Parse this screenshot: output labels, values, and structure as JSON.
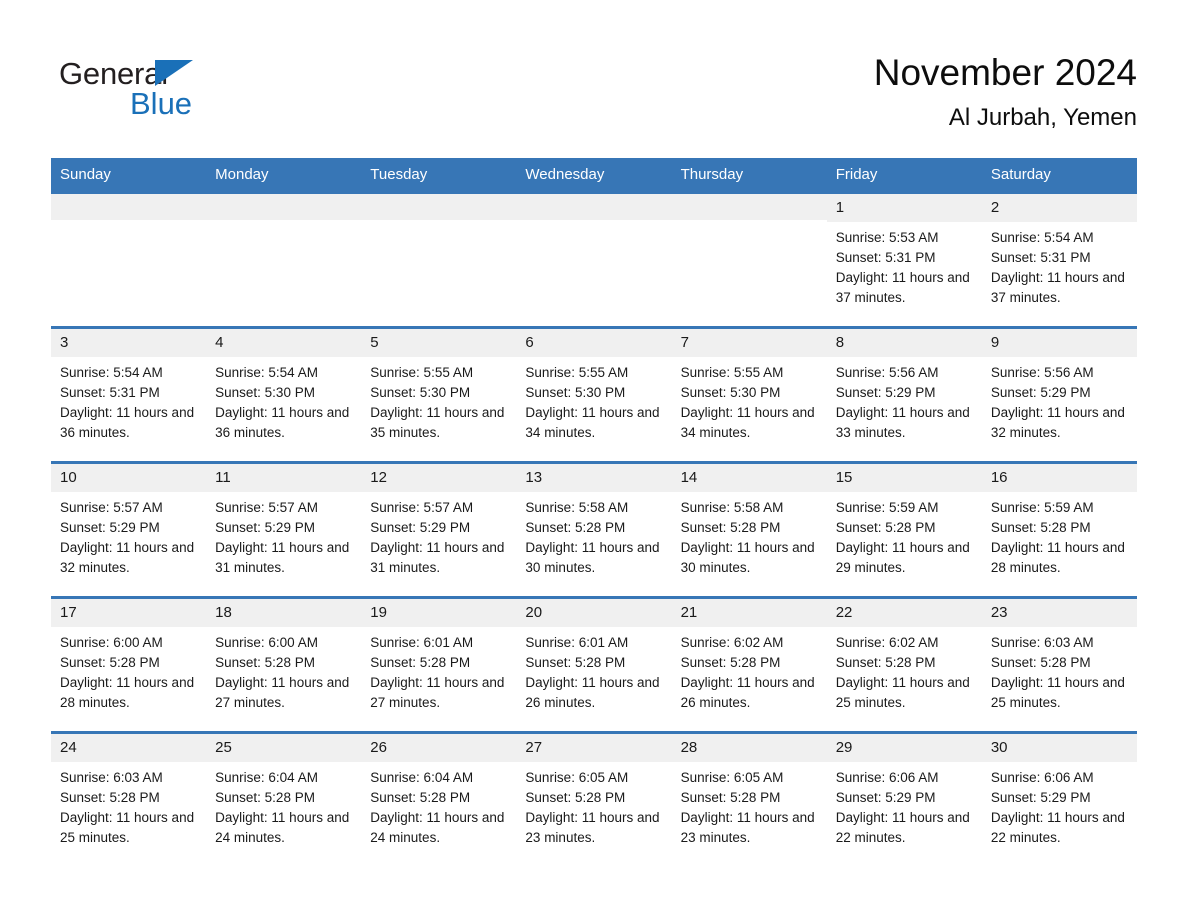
{
  "brand": {
    "name_top": "General",
    "name_bottom": "Blue",
    "triangle_color": "#1a70b8"
  },
  "header": {
    "title": "November 2024",
    "subtitle": "Al Jurbah, Yemen"
  },
  "theme": {
    "header_blue": "#3776b6",
    "daynum_band": "#f0f0f0",
    "text": "#1a1a1a"
  },
  "weekday_headers": [
    "Sunday",
    "Monday",
    "Tuesday",
    "Wednesday",
    "Thursday",
    "Friday",
    "Saturday"
  ],
  "labels": {
    "sunrise_prefix": "Sunrise:",
    "sunset_prefix": "Sunset:",
    "daylight_prefix": "Daylight:"
  },
  "weeks": [
    [
      {
        "day": "",
        "sunrise": "",
        "sunset": "",
        "daylight": ""
      },
      {
        "day": "",
        "sunrise": "",
        "sunset": "",
        "daylight": ""
      },
      {
        "day": "",
        "sunrise": "",
        "sunset": "",
        "daylight": ""
      },
      {
        "day": "",
        "sunrise": "",
        "sunset": "",
        "daylight": ""
      },
      {
        "day": "",
        "sunrise": "",
        "sunset": "",
        "daylight": ""
      },
      {
        "day": "1",
        "sunrise": "Sunrise: 5:53 AM",
        "sunset": "Sunset: 5:31 PM",
        "daylight": "Daylight: 11 hours and 37 minutes."
      },
      {
        "day": "2",
        "sunrise": "Sunrise: 5:54 AM",
        "sunset": "Sunset: 5:31 PM",
        "daylight": "Daylight: 11 hours and 37 minutes."
      }
    ],
    [
      {
        "day": "3",
        "sunrise": "Sunrise: 5:54 AM",
        "sunset": "Sunset: 5:31 PM",
        "daylight": "Daylight: 11 hours and 36 minutes."
      },
      {
        "day": "4",
        "sunrise": "Sunrise: 5:54 AM",
        "sunset": "Sunset: 5:30 PM",
        "daylight": "Daylight: 11 hours and 36 minutes."
      },
      {
        "day": "5",
        "sunrise": "Sunrise: 5:55 AM",
        "sunset": "Sunset: 5:30 PM",
        "daylight": "Daylight: 11 hours and 35 minutes."
      },
      {
        "day": "6",
        "sunrise": "Sunrise: 5:55 AM",
        "sunset": "Sunset: 5:30 PM",
        "daylight": "Daylight: 11 hours and 34 minutes."
      },
      {
        "day": "7",
        "sunrise": "Sunrise: 5:55 AM",
        "sunset": "Sunset: 5:30 PM",
        "daylight": "Daylight: 11 hours and 34 minutes."
      },
      {
        "day": "8",
        "sunrise": "Sunrise: 5:56 AM",
        "sunset": "Sunset: 5:29 PM",
        "daylight": "Daylight: 11 hours and 33 minutes."
      },
      {
        "day": "9",
        "sunrise": "Sunrise: 5:56 AM",
        "sunset": "Sunset: 5:29 PM",
        "daylight": "Daylight: 11 hours and 32 minutes."
      }
    ],
    [
      {
        "day": "10",
        "sunrise": "Sunrise: 5:57 AM",
        "sunset": "Sunset: 5:29 PM",
        "daylight": "Daylight: 11 hours and 32 minutes."
      },
      {
        "day": "11",
        "sunrise": "Sunrise: 5:57 AM",
        "sunset": "Sunset: 5:29 PM",
        "daylight": "Daylight: 11 hours and 31 minutes."
      },
      {
        "day": "12",
        "sunrise": "Sunrise: 5:57 AM",
        "sunset": "Sunset: 5:29 PM",
        "daylight": "Daylight: 11 hours and 31 minutes."
      },
      {
        "day": "13",
        "sunrise": "Sunrise: 5:58 AM",
        "sunset": "Sunset: 5:28 PM",
        "daylight": "Daylight: 11 hours and 30 minutes."
      },
      {
        "day": "14",
        "sunrise": "Sunrise: 5:58 AM",
        "sunset": "Sunset: 5:28 PM",
        "daylight": "Daylight: 11 hours and 30 minutes."
      },
      {
        "day": "15",
        "sunrise": "Sunrise: 5:59 AM",
        "sunset": "Sunset: 5:28 PM",
        "daylight": "Daylight: 11 hours and 29 minutes."
      },
      {
        "day": "16",
        "sunrise": "Sunrise: 5:59 AM",
        "sunset": "Sunset: 5:28 PM",
        "daylight": "Daylight: 11 hours and 28 minutes."
      }
    ],
    [
      {
        "day": "17",
        "sunrise": "Sunrise: 6:00 AM",
        "sunset": "Sunset: 5:28 PM",
        "daylight": "Daylight: 11 hours and 28 minutes."
      },
      {
        "day": "18",
        "sunrise": "Sunrise: 6:00 AM",
        "sunset": "Sunset: 5:28 PM",
        "daylight": "Daylight: 11 hours and 27 minutes."
      },
      {
        "day": "19",
        "sunrise": "Sunrise: 6:01 AM",
        "sunset": "Sunset: 5:28 PM",
        "daylight": "Daylight: 11 hours and 27 minutes."
      },
      {
        "day": "20",
        "sunrise": "Sunrise: 6:01 AM",
        "sunset": "Sunset: 5:28 PM",
        "daylight": "Daylight: 11 hours and 26 minutes."
      },
      {
        "day": "21",
        "sunrise": "Sunrise: 6:02 AM",
        "sunset": "Sunset: 5:28 PM",
        "daylight": "Daylight: 11 hours and 26 minutes."
      },
      {
        "day": "22",
        "sunrise": "Sunrise: 6:02 AM",
        "sunset": "Sunset: 5:28 PM",
        "daylight": "Daylight: 11 hours and 25 minutes."
      },
      {
        "day": "23",
        "sunrise": "Sunrise: 6:03 AM",
        "sunset": "Sunset: 5:28 PM",
        "daylight": "Daylight: 11 hours and 25 minutes."
      }
    ],
    [
      {
        "day": "24",
        "sunrise": "Sunrise: 6:03 AM",
        "sunset": "Sunset: 5:28 PM",
        "daylight": "Daylight: 11 hours and 25 minutes."
      },
      {
        "day": "25",
        "sunrise": "Sunrise: 6:04 AM",
        "sunset": "Sunset: 5:28 PM",
        "daylight": "Daylight: 11 hours and 24 minutes."
      },
      {
        "day": "26",
        "sunrise": "Sunrise: 6:04 AM",
        "sunset": "Sunset: 5:28 PM",
        "daylight": "Daylight: 11 hours and 24 minutes."
      },
      {
        "day": "27",
        "sunrise": "Sunrise: 6:05 AM",
        "sunset": "Sunset: 5:28 PM",
        "daylight": "Daylight: 11 hours and 23 minutes."
      },
      {
        "day": "28",
        "sunrise": "Sunrise: 6:05 AM",
        "sunset": "Sunset: 5:28 PM",
        "daylight": "Daylight: 11 hours and 23 minutes."
      },
      {
        "day": "29",
        "sunrise": "Sunrise: 6:06 AM",
        "sunset": "Sunset: 5:29 PM",
        "daylight": "Daylight: 11 hours and 22 minutes."
      },
      {
        "day": "30",
        "sunrise": "Sunrise: 6:06 AM",
        "sunset": "Sunset: 5:29 PM",
        "daylight": "Daylight: 11 hours and 22 minutes."
      }
    ]
  ]
}
